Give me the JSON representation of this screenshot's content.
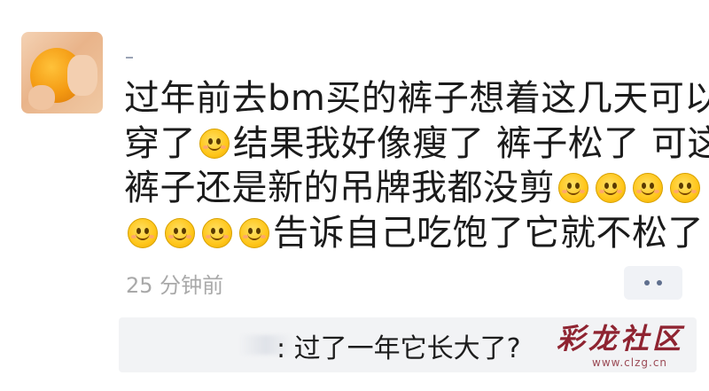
{
  "post": {
    "lines": [
      [
        "过年前去bm买的裤子想着这几天可以"
      ],
      [
        "穿了",
        "smile",
        "结果我好像瘦了 裤子松了 可这"
      ],
      [
        "裤子还是新的吊牌我都没剪",
        "smile",
        "smile",
        "smile",
        "smile"
      ],
      [
        "smile",
        "smile",
        "smile",
        "smile",
        "告诉自己吃饱了它就不松了"
      ]
    ],
    "emoji_icon": "smiley-emoji"
  },
  "timestamp": "25 分钟前",
  "comment": {
    "text": ": 过了一年它长大了?"
  },
  "watermark": {
    "title": "彩龙社区",
    "url": "www.clzg.cn"
  },
  "icons": {
    "avatar": "avatar-orange-photo",
    "more": "more-dots-icon"
  },
  "colors": {
    "timestamp": "#a9a9a9",
    "comment_bg": "#f2f3f5",
    "watermark": "#8f2431",
    "more_button_bg": "#f0f2f6"
  }
}
